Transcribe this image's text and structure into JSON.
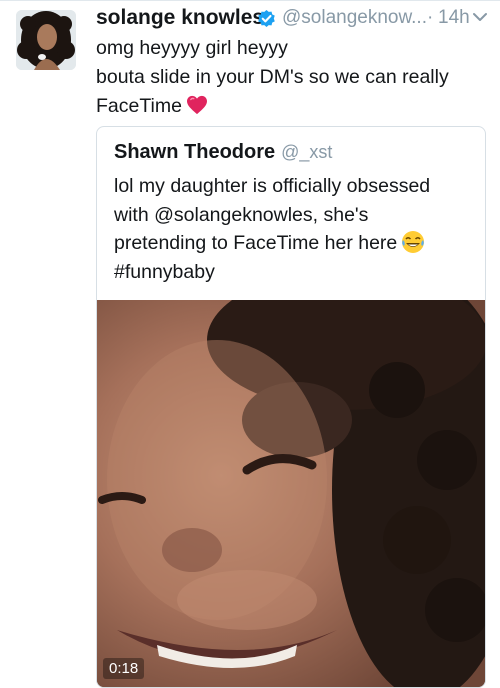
{
  "tweet": {
    "author_name": "solange knowles",
    "author_handle": "@solangeknow...",
    "separator": "·",
    "timestamp": "14h",
    "verified": true,
    "text_lines": [
      "omg heyyyy girl heyyy",
      "bouta slide in your DM's so we can really",
      "FaceTime"
    ],
    "emoji": "red-heart"
  },
  "quoted_tweet": {
    "author_name": "Shawn Theodore",
    "author_handle": "@_xst",
    "text_lines": [
      "lol my daughter is officially obsessed",
      "with @solangeknowles, she's",
      "pretending to FaceTime her here",
      "#funnybaby"
    ],
    "emoji": "face-with-tears-of-joy",
    "video": {
      "duration": "0:18"
    }
  },
  "icons": {
    "verified": "verified-badge-icon",
    "menu": "chevron-down-icon"
  },
  "colors": {
    "primary_text": "#14171a",
    "secondary_text": "#8899a6",
    "verified_blue": "#1da1f2",
    "border": "#d7dfe5",
    "heart_red": "#e0245e"
  }
}
